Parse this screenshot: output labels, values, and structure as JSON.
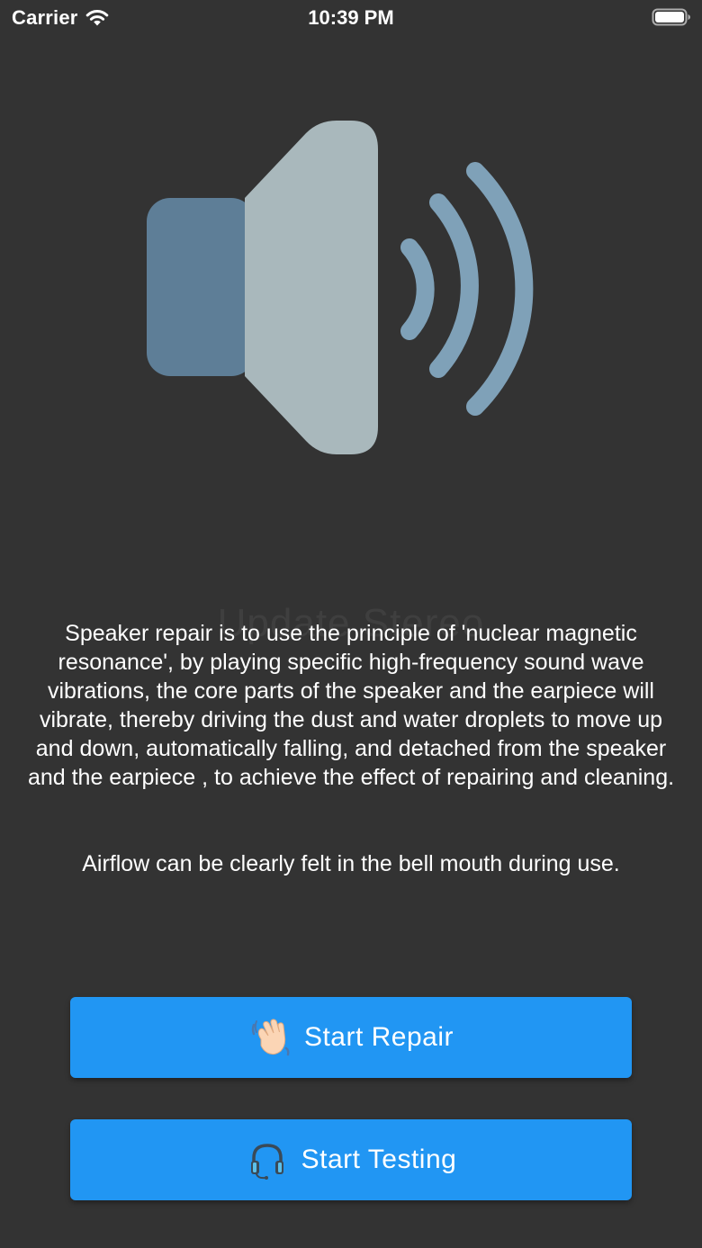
{
  "status_bar": {
    "carrier": "Carrier",
    "time": "10:39 PM"
  },
  "illustration": {
    "name": "speaker-with-sound-waves",
    "colors": {
      "speaker_back": "#5E7E97",
      "speaker_cone": "#A9B8BC",
      "waves": "#7FA1B8"
    }
  },
  "ghost_title": "Update Stereo",
  "description": "Speaker repair is to use the principle of 'nuclear magnetic resonance', by playing specific high-frequency sound wave vibrations, the core parts of the speaker and the earpiece will vibrate, thereby driving the dust and water droplets to move up and down, automatically falling, and detached from the speaker and the earpiece , to achieve the effect of repairing and cleaning.",
  "airflow_note": "Airflow can be clearly felt in the bell mouth during use.",
  "buttons": {
    "repair": {
      "label": "Start Repair",
      "icon": "waving-hand-icon"
    },
    "testing": {
      "label": "Start Testing",
      "icon": "headphones-icon"
    }
  },
  "colors": {
    "background": "#333333",
    "button": "#2196F3",
    "text": "#FFFFFF"
  }
}
